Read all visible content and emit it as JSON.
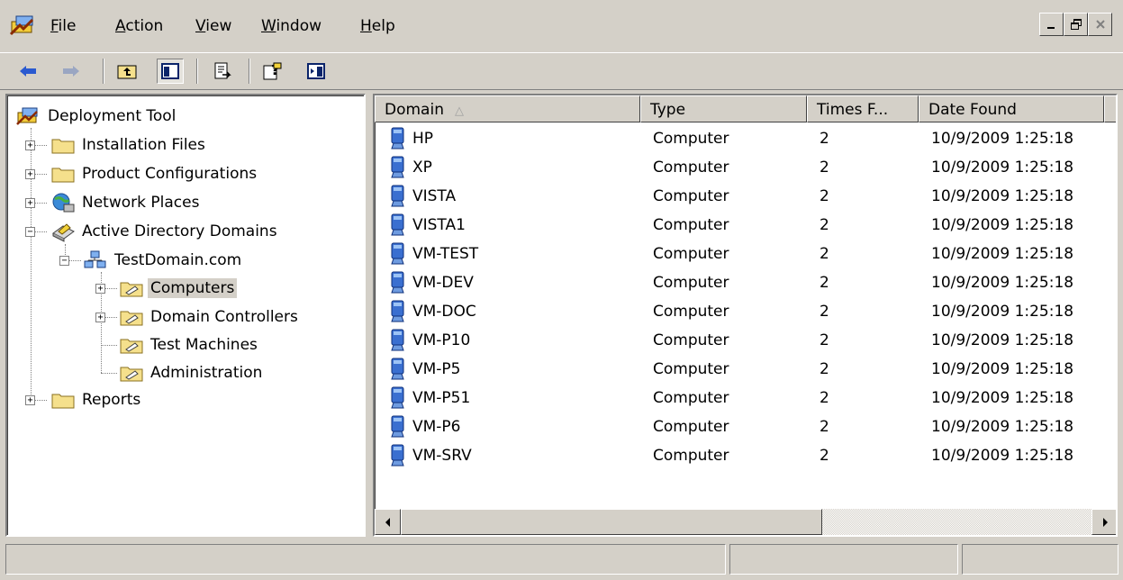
{
  "menu": {
    "file": "File",
    "action": "Action",
    "view": "View",
    "window": "Window",
    "help": "Help"
  },
  "window_controls": [
    "minimize",
    "restore",
    "close"
  ],
  "toolbar": {
    "buttons": [
      "back-arrow-icon",
      "forward-arrow-icon",
      "up-one-level-icon",
      "show-hide-console-tree-icon",
      "export-list-icon",
      "help-icon",
      "show-hide-action-pane-icon"
    ]
  },
  "tree": {
    "root": "Deployment Tool",
    "installation_files": "Installation Files",
    "product_configurations": "Product Configurations",
    "network_places": "Network Places",
    "active_directory_domains": "Active Directory Domains",
    "test_domain": "TestDomain.com",
    "computers": "Computers",
    "domain_controllers": "Domain Controllers",
    "test_machines": "Test Machines",
    "administration": "Administration",
    "reports": "Reports"
  },
  "list": {
    "columns": {
      "domain": "Domain",
      "type": "Type",
      "times_found": "Times F...",
      "date_found": "Date Found"
    },
    "rows": [
      {
        "domain": "HP",
        "type": "Computer",
        "times": "2",
        "date": "10/9/2009 1:25:18"
      },
      {
        "domain": "XP",
        "type": "Computer",
        "times": "2",
        "date": "10/9/2009 1:25:18"
      },
      {
        "domain": "VISTA",
        "type": "Computer",
        "times": "2",
        "date": "10/9/2009 1:25:18"
      },
      {
        "domain": "VISTA1",
        "type": "Computer",
        "times": "2",
        "date": "10/9/2009 1:25:18"
      },
      {
        "domain": "VM-TEST",
        "type": "Computer",
        "times": "2",
        "date": "10/9/2009 1:25:18"
      },
      {
        "domain": "VM-DEV",
        "type": "Computer",
        "times": "2",
        "date": "10/9/2009 1:25:18"
      },
      {
        "domain": "VM-DOC",
        "type": "Computer",
        "times": "2",
        "date": "10/9/2009 1:25:18"
      },
      {
        "domain": "VM-P10",
        "type": "Computer",
        "times": "2",
        "date": "10/9/2009 1:25:18"
      },
      {
        "domain": "VM-P5",
        "type": "Computer",
        "times": "2",
        "date": "10/9/2009 1:25:18"
      },
      {
        "domain": "VM-P51",
        "type": "Computer",
        "times": "2",
        "date": "10/9/2009 1:25:18"
      },
      {
        "domain": "VM-P6",
        "type": "Computer",
        "times": "2",
        "date": "10/9/2009 1:25:18"
      },
      {
        "domain": "VM-SRV",
        "type": "Computer",
        "times": "2",
        "date": "10/9/2009 1:25:18"
      }
    ]
  },
  "colors": {
    "chrome": "#d4d0c8",
    "folder": "#f5e08c",
    "computer_icon": "#3a6fd0"
  }
}
